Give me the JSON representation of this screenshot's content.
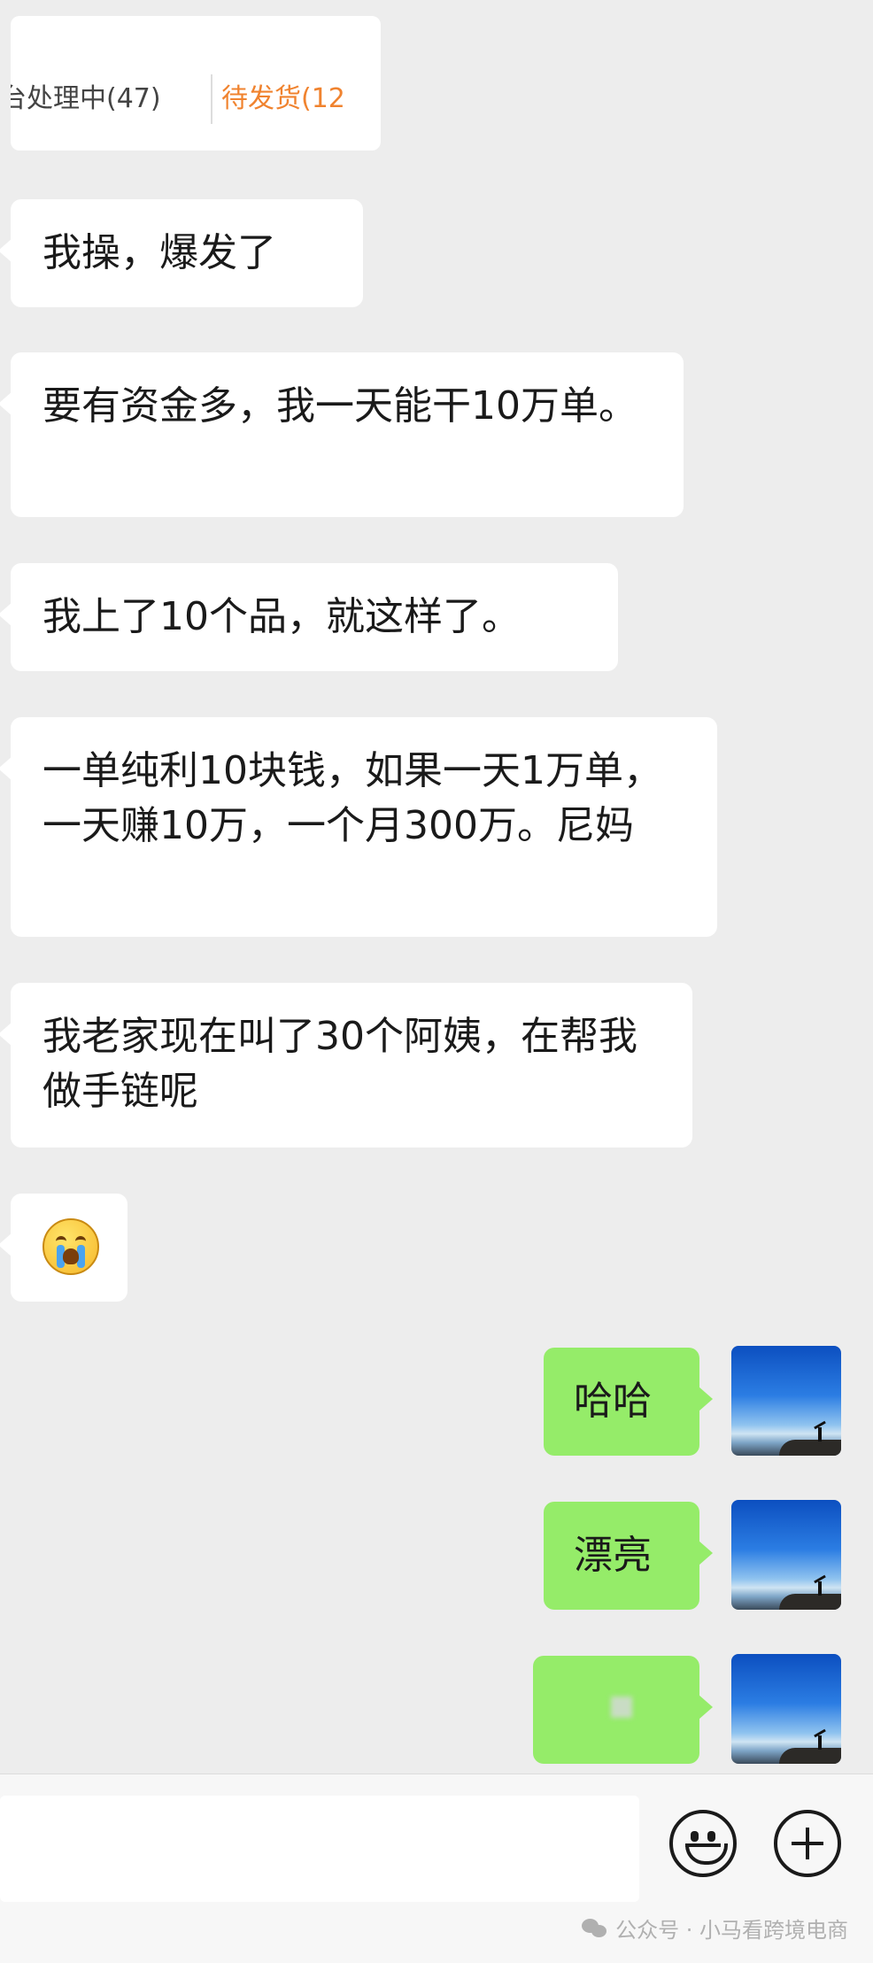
{
  "quoted_screenshot": {
    "tabs": [
      {
        "label": "台处理中(47)"
      },
      {
        "label": "待发货(12"
      }
    ]
  },
  "messages_in": [
    {
      "text": "我操，爆发了"
    },
    {
      "text": "要有资金多，我一天能干10万单。"
    },
    {
      "text": "我上了10个品，就这样了。"
    },
    {
      "text": "一单纯利10块钱，如果一天1万单，一天赚10万，一个月300万。尼妈"
    },
    {
      "text": "我老家现在叫了30个阿姨，在帮我做手链呢"
    },
    {
      "emoji": "crying-emoji"
    }
  ],
  "messages_out": [
    {
      "text": "哈哈"
    },
    {
      "text": "漂亮"
    },
    {
      "text": ""
    }
  ],
  "input_bar": {
    "placeholder": "",
    "emoji_button": "smiley-icon",
    "more_button": "plus-icon"
  },
  "watermark": {
    "text": "公众号 · 小马看跨境电商"
  },
  "colors": {
    "background": "#ededed",
    "incoming_bubble": "#ffffff",
    "outgoing_bubble": "#95ec69",
    "active_tab": "#f0832f"
  }
}
